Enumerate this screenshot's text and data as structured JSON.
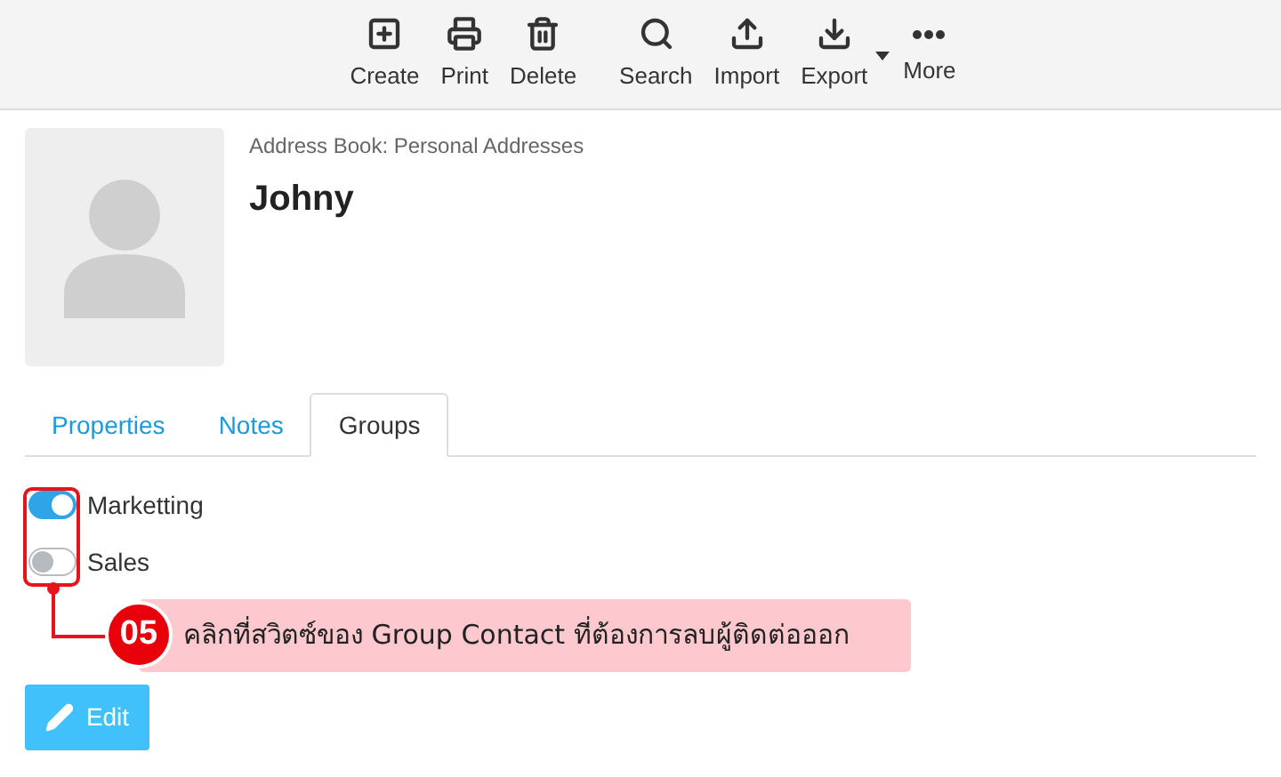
{
  "toolbar": [
    {
      "kind": "create",
      "label": "Create"
    },
    {
      "kind": "print",
      "label": "Print"
    },
    {
      "kind": "delete",
      "label": "Delete"
    },
    {
      "kind": "search",
      "label": "Search"
    },
    {
      "kind": "import",
      "label": "Import"
    },
    {
      "kind": "export",
      "label": "Export",
      "menu": true
    },
    {
      "kind": "more",
      "label": "More"
    }
  ],
  "contact": {
    "address_book": "Address Book: Personal Addresses",
    "name": "Johny"
  },
  "tabs": [
    {
      "label": "Properties",
      "selected": false
    },
    {
      "label": "Notes",
      "selected": false
    },
    {
      "label": "Groups",
      "selected": true
    }
  ],
  "groups": [
    {
      "label": "Marketting",
      "on": true
    },
    {
      "label": "Sales",
      "on": false
    }
  ],
  "callout": {
    "step": "05",
    "text": "คลิกที่สวิตซ์ของ Group Contact ที่ต้องการลบผู้ติดต่อออก"
  },
  "edit_button": "Edit"
}
